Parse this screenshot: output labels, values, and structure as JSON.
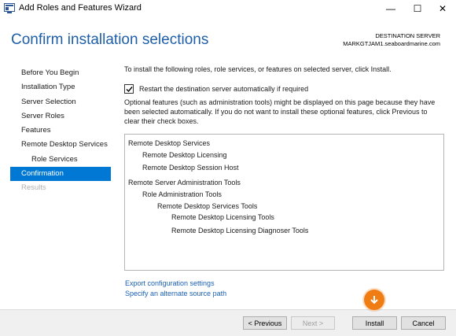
{
  "window": {
    "title": "Add Roles and Features Wizard",
    "minimize_glyph": "—",
    "maximize_glyph": "☐",
    "close_glyph": "✕"
  },
  "header": {
    "page_title": "Confirm installation selections",
    "destination_label": "DESTINATION SERVER",
    "destination_server": "MARKGTJAM1.seaboardmarine.com"
  },
  "sidebar": {
    "items": [
      {
        "label": "Before You Begin"
      },
      {
        "label": "Installation Type"
      },
      {
        "label": "Server Selection"
      },
      {
        "label": "Server Roles"
      },
      {
        "label": "Features"
      },
      {
        "label": "Remote Desktop Services"
      },
      {
        "label": "Role Services"
      },
      {
        "label": "Confirmation"
      },
      {
        "label": "Results"
      }
    ]
  },
  "content": {
    "intro": "To install the following roles, role services, or features on selected server, click Install.",
    "restart_label": "Restart the destination server automatically if required",
    "restart_checked": true,
    "optional_note": "Optional features (such as administration tools) might be displayed on this page because they have been selected automatically. If you do not want to install these optional features, click Previous to clear their check boxes."
  },
  "selections": [
    {
      "text": "Remote Desktop Services"
    },
    {
      "text": "Remote Desktop Licensing"
    },
    {
      "text": "Remote Desktop Session Host"
    },
    {
      "text": "Remote Server Administration Tools"
    },
    {
      "text": "Role Administration Tools"
    },
    {
      "text": "Remote Desktop Services Tools"
    },
    {
      "text": "Remote Desktop Licensing Tools"
    },
    {
      "text": "Remote Desktop Licensing Diagnoser Tools"
    }
  ],
  "links": {
    "export": "Export configuration settings",
    "alternate_source": "Specify an alternate source path"
  },
  "buttons": {
    "previous": "< Previous",
    "next": "Next >",
    "install": "Install",
    "cancel": "Cancel"
  },
  "colors": {
    "accent": "#0078d4",
    "heading": "#1f5fa8",
    "highlight_marker": "#f07c14"
  },
  "icons": {
    "app": "server-manager-icon",
    "checkbox": "checkmark-icon",
    "marker": "arrow-down-icon"
  }
}
